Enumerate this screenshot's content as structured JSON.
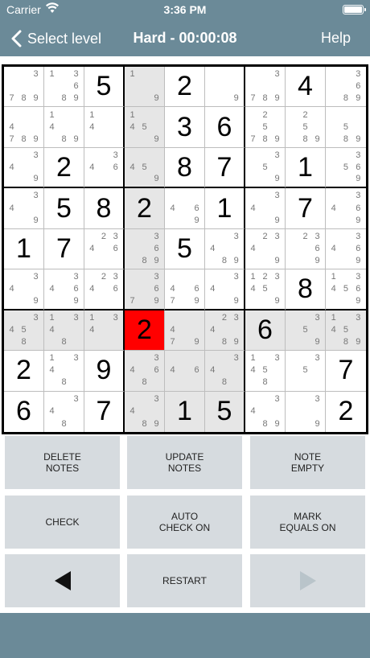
{
  "status": {
    "carrier": "Carrier",
    "time": "3:36 PM"
  },
  "nav": {
    "back_label": "Select level",
    "title": "Hard - 00:00:08",
    "help_label": "Help"
  },
  "board": {
    "selected": {
      "row": 6,
      "col": 3
    },
    "cells": [
      [
        {
          "n": [
            3,
            7,
            8,
            9
          ]
        },
        {
          "n": [
            1,
            3,
            6,
            8,
            9
          ]
        },
        {
          "v": "5"
        },
        {
          "n": [
            1,
            9
          ]
        },
        {
          "v": "2"
        },
        {
          "n": [
            9
          ]
        },
        {
          "n": [
            3,
            7,
            8,
            9
          ]
        },
        {
          "v": "4"
        },
        {
          "n": [
            3,
            6,
            8,
            9
          ]
        }
      ],
      [
        {
          "n": [
            4,
            7,
            8,
            9
          ]
        },
        {
          "n": [
            1,
            4,
            8,
            9
          ]
        },
        {
          "n": [
            1,
            4
          ]
        },
        {
          "n": [
            1,
            4,
            5,
            9
          ]
        },
        {
          "v": "3"
        },
        {
          "v": "6"
        },
        {
          "n": [
            2,
            5,
            7,
            8,
            9
          ]
        },
        {
          "n": [
            2,
            5,
            8,
            9
          ]
        },
        {
          "n": [
            5,
            8,
            9
          ]
        }
      ],
      [
        {
          "n": [
            3,
            4,
            9
          ]
        },
        {
          "v": "2"
        },
        {
          "n": [
            3,
            4,
            6
          ]
        },
        {
          "n": [
            4,
            5,
            9
          ]
        },
        {
          "v": "8"
        },
        {
          "v": "7"
        },
        {
          "n": [
            3,
            5,
            9
          ]
        },
        {
          "v": "1"
        },
        {
          "n": [
            3,
            5,
            6,
            9
          ]
        }
      ],
      [
        {
          "n": [
            3,
            4,
            9
          ]
        },
        {
          "v": "5"
        },
        {
          "v": "8"
        },
        {
          "v": "2"
        },
        {
          "n": [
            4,
            6,
            9
          ]
        },
        {
          "v": "1"
        },
        {
          "n": [
            3,
            4,
            9
          ]
        },
        {
          "v": "7"
        },
        {
          "n": [
            3,
            4,
            6,
            9
          ]
        }
      ],
      [
        {
          "v": "1"
        },
        {
          "v": "7"
        },
        {
          "n": [
            2,
            3,
            4,
            6
          ]
        },
        {
          "n": [
            3,
            6,
            8,
            9
          ]
        },
        {
          "v": "5"
        },
        {
          "n": [
            3,
            4,
            8,
            9
          ]
        },
        {
          "n": [
            2,
            3,
            4,
            9
          ]
        },
        {
          "n": [
            2,
            3,
            6,
            9
          ]
        },
        {
          "n": [
            3,
            4,
            6,
            9
          ]
        }
      ],
      [
        {
          "n": [
            3,
            4,
            9
          ]
        },
        {
          "n": [
            3,
            4,
            6,
            9
          ]
        },
        {
          "n": [
            2,
            3,
            4,
            6
          ]
        },
        {
          "n": [
            3,
            6,
            7,
            9
          ]
        },
        {
          "n": [
            4,
            6,
            7,
            9
          ]
        },
        {
          "n": [
            3,
            4,
            9
          ]
        },
        {
          "n": [
            1,
            2,
            3,
            4,
            5,
            9
          ]
        },
        {
          "v": "8"
        },
        {
          "n": [
            1,
            3,
            4,
            5,
            6,
            9
          ]
        }
      ],
      [
        {
          "n": [
            3,
            4,
            5,
            8
          ]
        },
        {
          "n": [
            1,
            3,
            4,
            8
          ]
        },
        {
          "n": [
            1,
            3,
            4
          ]
        },
        {
          "v": "2"
        },
        {
          "n": [
            4,
            7,
            9
          ]
        },
        {
          "n": [
            2,
            3,
            4,
            8,
            9
          ]
        },
        {
          "v": "6"
        },
        {
          "n": [
            3,
            5,
            9
          ]
        },
        {
          "n": [
            1,
            3,
            4,
            5,
            8,
            9
          ]
        }
      ],
      [
        {
          "v": "2"
        },
        {
          "n": [
            1,
            3,
            4,
            8
          ]
        },
        {
          "v": "9"
        },
        {
          "n": [
            3,
            4,
            6,
            8
          ]
        },
        {
          "n": [
            4,
            6
          ]
        },
        {
          "n": [
            3,
            4,
            8
          ]
        },
        {
          "n": [
            1,
            3,
            4,
            5,
            8
          ]
        },
        {
          "n": [
            3,
            5
          ]
        },
        {
          "v": "7"
        }
      ],
      [
        {
          "v": "6"
        },
        {
          "n": [
            3,
            4,
            8
          ]
        },
        {
          "v": "7"
        },
        {
          "n": [
            3,
            4,
            8,
            9
          ]
        },
        {
          "v": "1"
        },
        {
          "v": "5"
        },
        {
          "n": [
            3,
            4,
            8,
            9
          ]
        },
        {
          "n": [
            3,
            9
          ]
        },
        {
          "v": "2"
        }
      ]
    ]
  },
  "controls": {
    "delete_notes": "DELETE\nNOTES",
    "update_notes": "UPDATE\nNOTES",
    "note_empty": "NOTE\nEMPTY",
    "check": "CHECK",
    "auto_check": "AUTO\nCHECK ON",
    "mark_equals": "MARK\nEQUALS ON",
    "restart": "RESTART"
  },
  "colors": {
    "selected_cell": "#ff0000",
    "highlight_cell": "#e6e6e6",
    "button_bg": "#d6dbdf",
    "header_bg": "#6b8a98"
  }
}
